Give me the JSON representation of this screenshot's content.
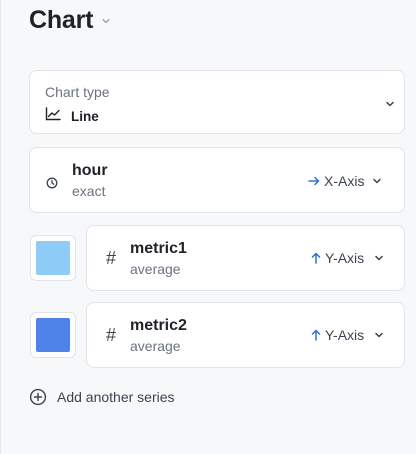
{
  "header": {
    "title": "Chart"
  },
  "chart_type": {
    "label": "Chart type",
    "value": "Line",
    "icon": "line-chart-icon"
  },
  "dimension": {
    "name": "hour",
    "sub": "exact",
    "axis_label": "X-Axis",
    "icon": "clock-icon",
    "axis_icon": "arrow-right-icon"
  },
  "series": [
    {
      "name": "metric1",
      "aggregation": "average",
      "axis_label": "Y-Axis",
      "color": "#8ecbf7",
      "icon": "hash-icon",
      "axis_icon": "arrow-up-icon"
    },
    {
      "name": "metric2",
      "aggregation": "average",
      "axis_label": "Y-Axis",
      "color": "#4e82e8",
      "icon": "hash-icon",
      "axis_icon": "arrow-up-icon"
    }
  ],
  "hash_glyph": "#",
  "add_series": {
    "label": "Add another series",
    "icon": "plus-circle-icon"
  },
  "colors": {
    "accent": "#2f6fd6",
    "text": "#1f2328",
    "muted": "#6b7280",
    "border": "#e1e4e8"
  }
}
